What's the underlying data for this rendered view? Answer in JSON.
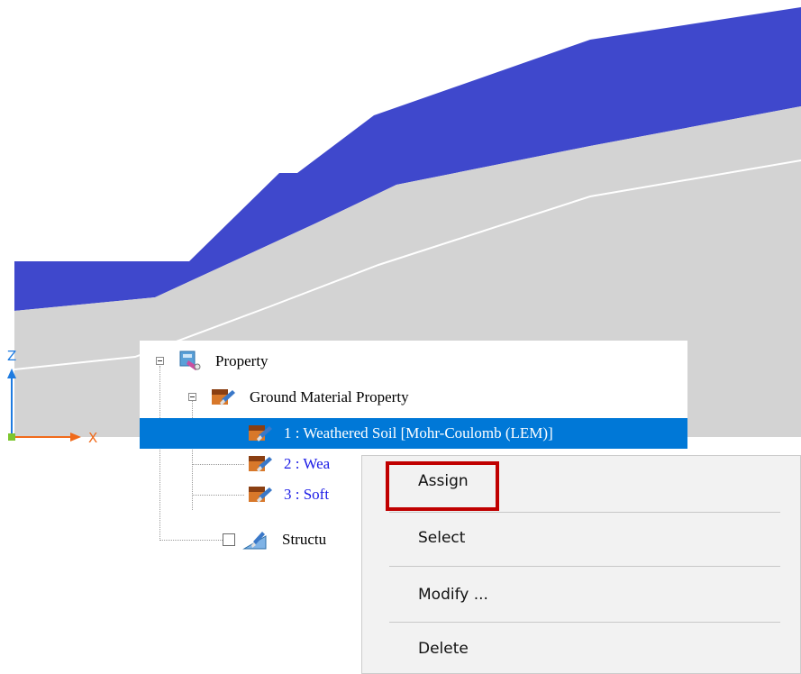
{
  "axes": {
    "z_label": "Z",
    "x_label": "X"
  },
  "colors": {
    "soil_top_layer": "#3f48cc",
    "soil_lower_layer": "#d3d3d3",
    "selection": "#0078d7",
    "highlight_box": "#c00000"
  },
  "tree": {
    "root": {
      "label": "Property",
      "icon": "property-icon"
    },
    "group": {
      "label": "Ground Material Property",
      "icon": "material-icon"
    },
    "items": [
      {
        "label": "1 : Weathered Soil [Mohr-Coulomb (LEM)]",
        "selected": true,
        "icon": "material-icon"
      },
      {
        "label": "2 : Wea",
        "selected": false,
        "icon": "material-icon"
      },
      {
        "label": "3 : Soft",
        "selected": false,
        "icon": "material-icon"
      }
    ],
    "structure": {
      "label": "Structu",
      "checked": false,
      "icon": "structure-icon"
    }
  },
  "context_menu": {
    "items": [
      {
        "label": "Assign",
        "highlighted": true
      },
      {
        "label": "Select"
      },
      {
        "label": "Modify ..."
      },
      {
        "label": "Delete"
      }
    ]
  }
}
